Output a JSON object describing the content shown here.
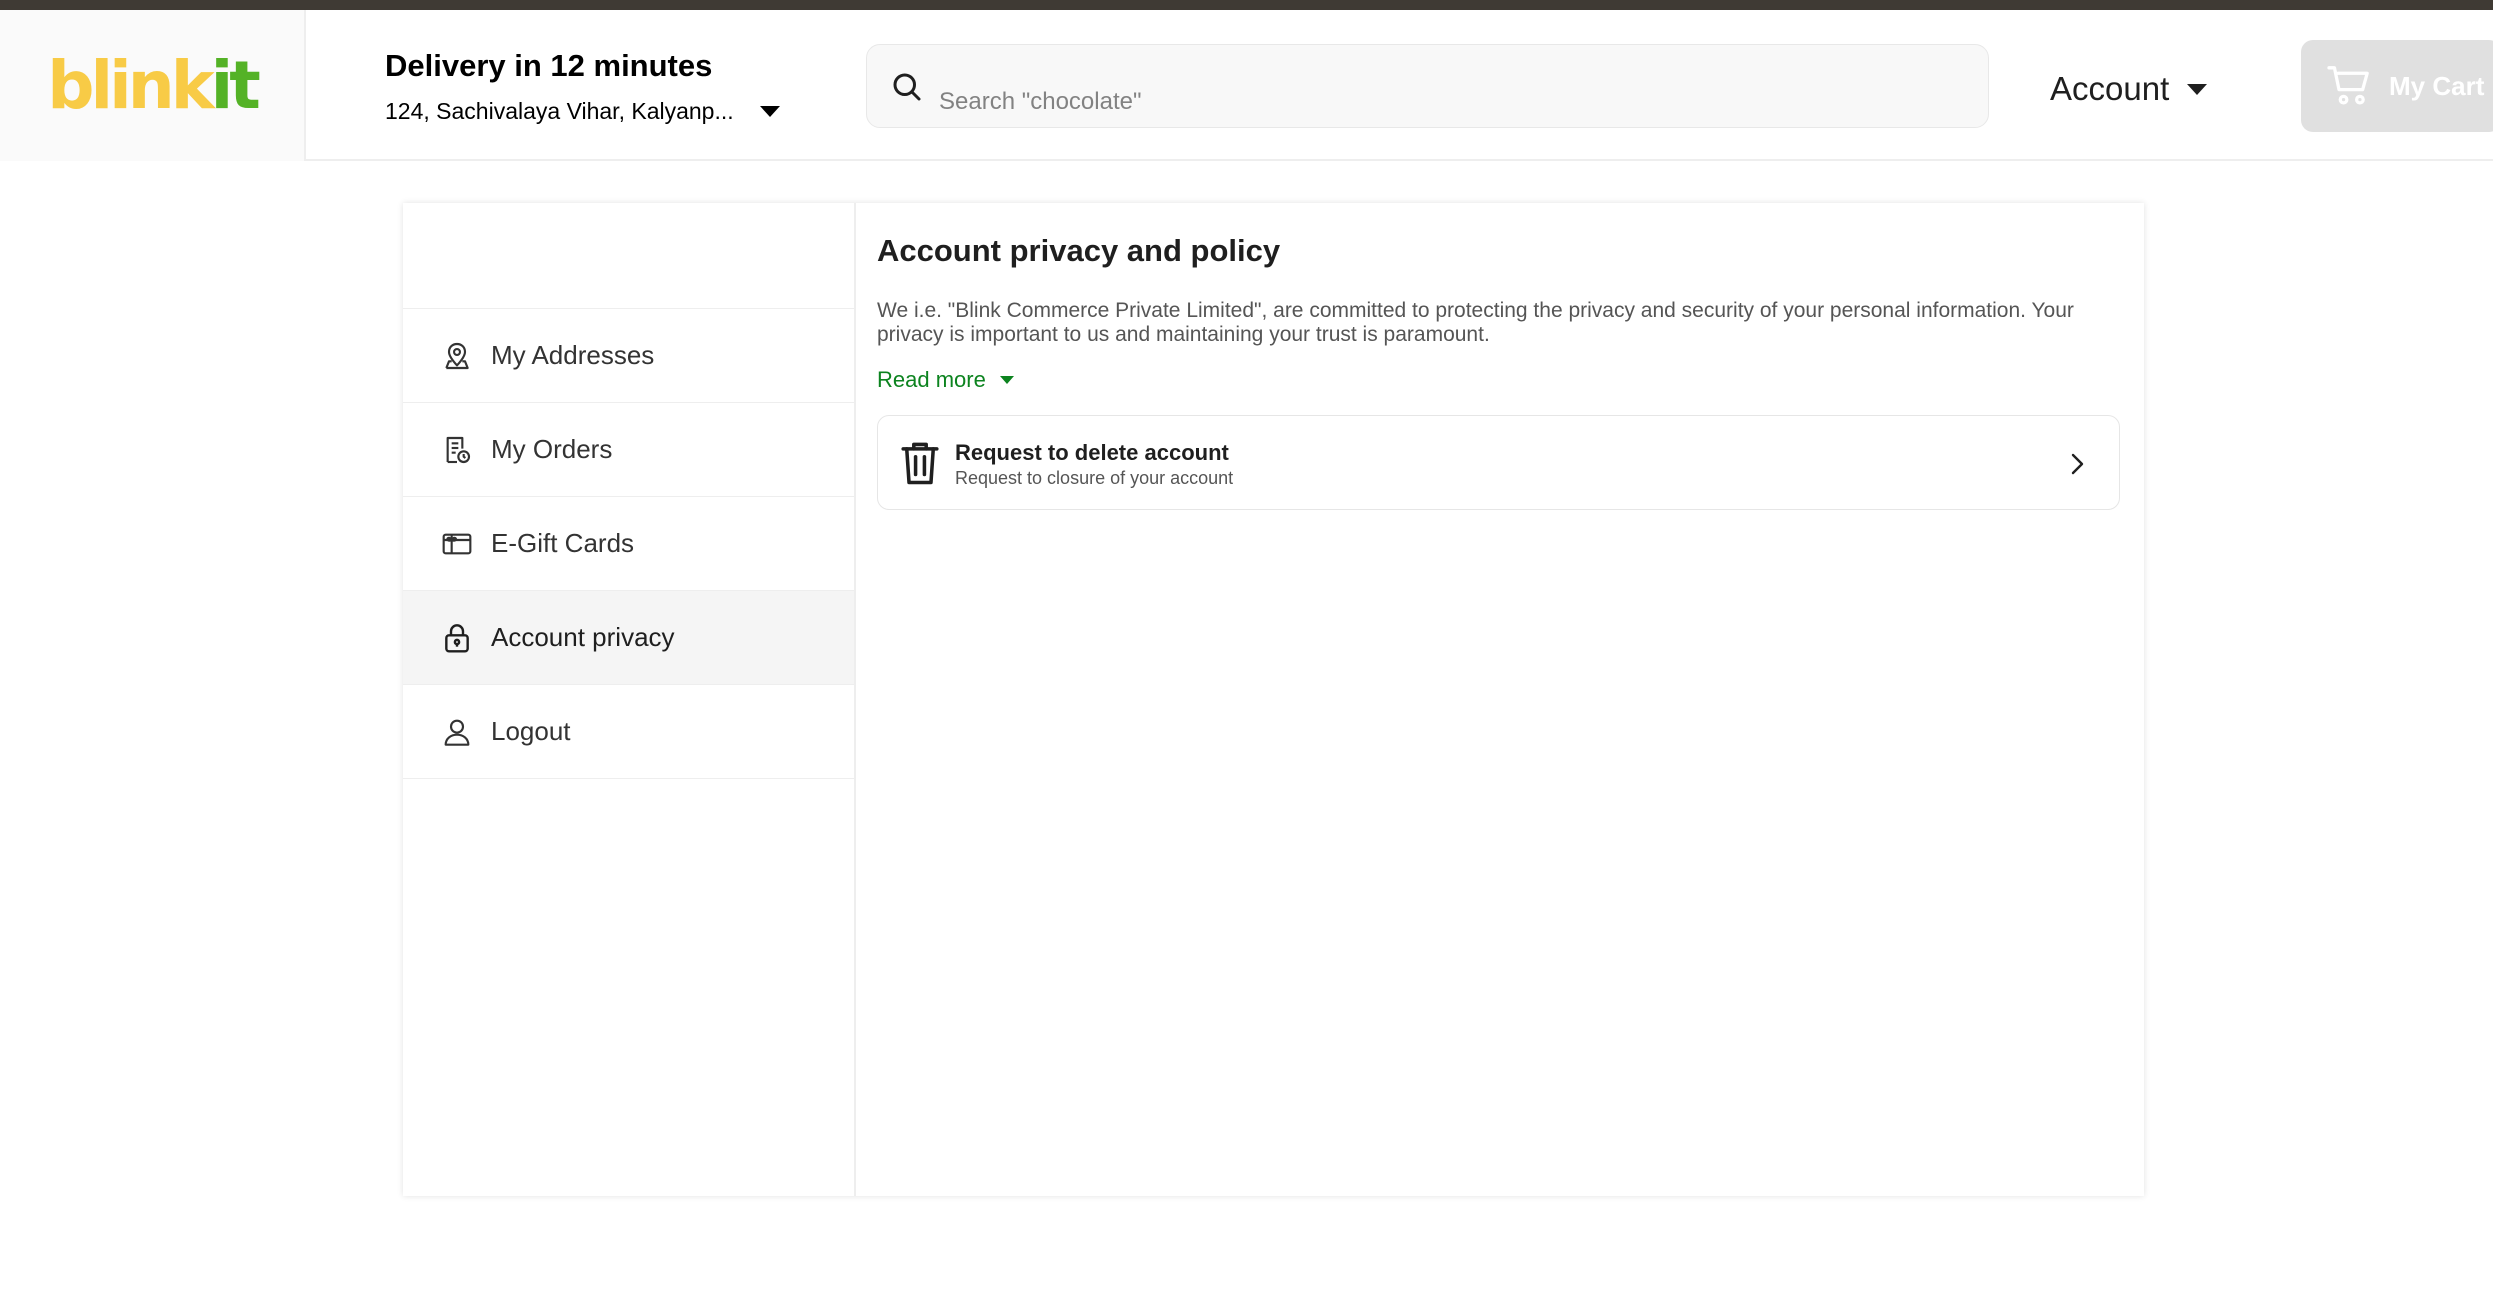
{
  "header": {
    "logo": {
      "part1": "blink",
      "part2": "it"
    },
    "delivery_title": "Delivery in 12 minutes",
    "delivery_address": "124, Sachivalaya Vihar, Kalyanp...",
    "search_placeholder": "Search \"chocolate\"",
    "account_label": "Account",
    "cart_label": "My Cart"
  },
  "sidebar": {
    "items": [
      {
        "label": "My Addresses",
        "icon": "location-pin-icon"
      },
      {
        "label": "My Orders",
        "icon": "receipt-icon"
      },
      {
        "label": "E-Gift Cards",
        "icon": "gift-card-icon"
      },
      {
        "label": "Account privacy",
        "icon": "lock-icon",
        "active": true
      },
      {
        "label": "Logout",
        "icon": "user-icon"
      }
    ]
  },
  "main": {
    "title": "Account privacy and policy",
    "description": "We i.e. \"Blink Commerce Private Limited\", are committed to protecting the privacy and security of your personal information. Your privacy is important to us and maintaining your trust is paramount.",
    "read_more": "Read more",
    "delete_card": {
      "title": "Request to delete account",
      "subtitle": "Request to closure of your account",
      "icon": "trash-icon"
    }
  },
  "colors": {
    "brand_yellow": "#f8cb46",
    "brand_green": "#54b226",
    "link_green": "#0c831f",
    "top_strip": "#3f3a34",
    "cart_disabled": "#e0e0e0"
  }
}
